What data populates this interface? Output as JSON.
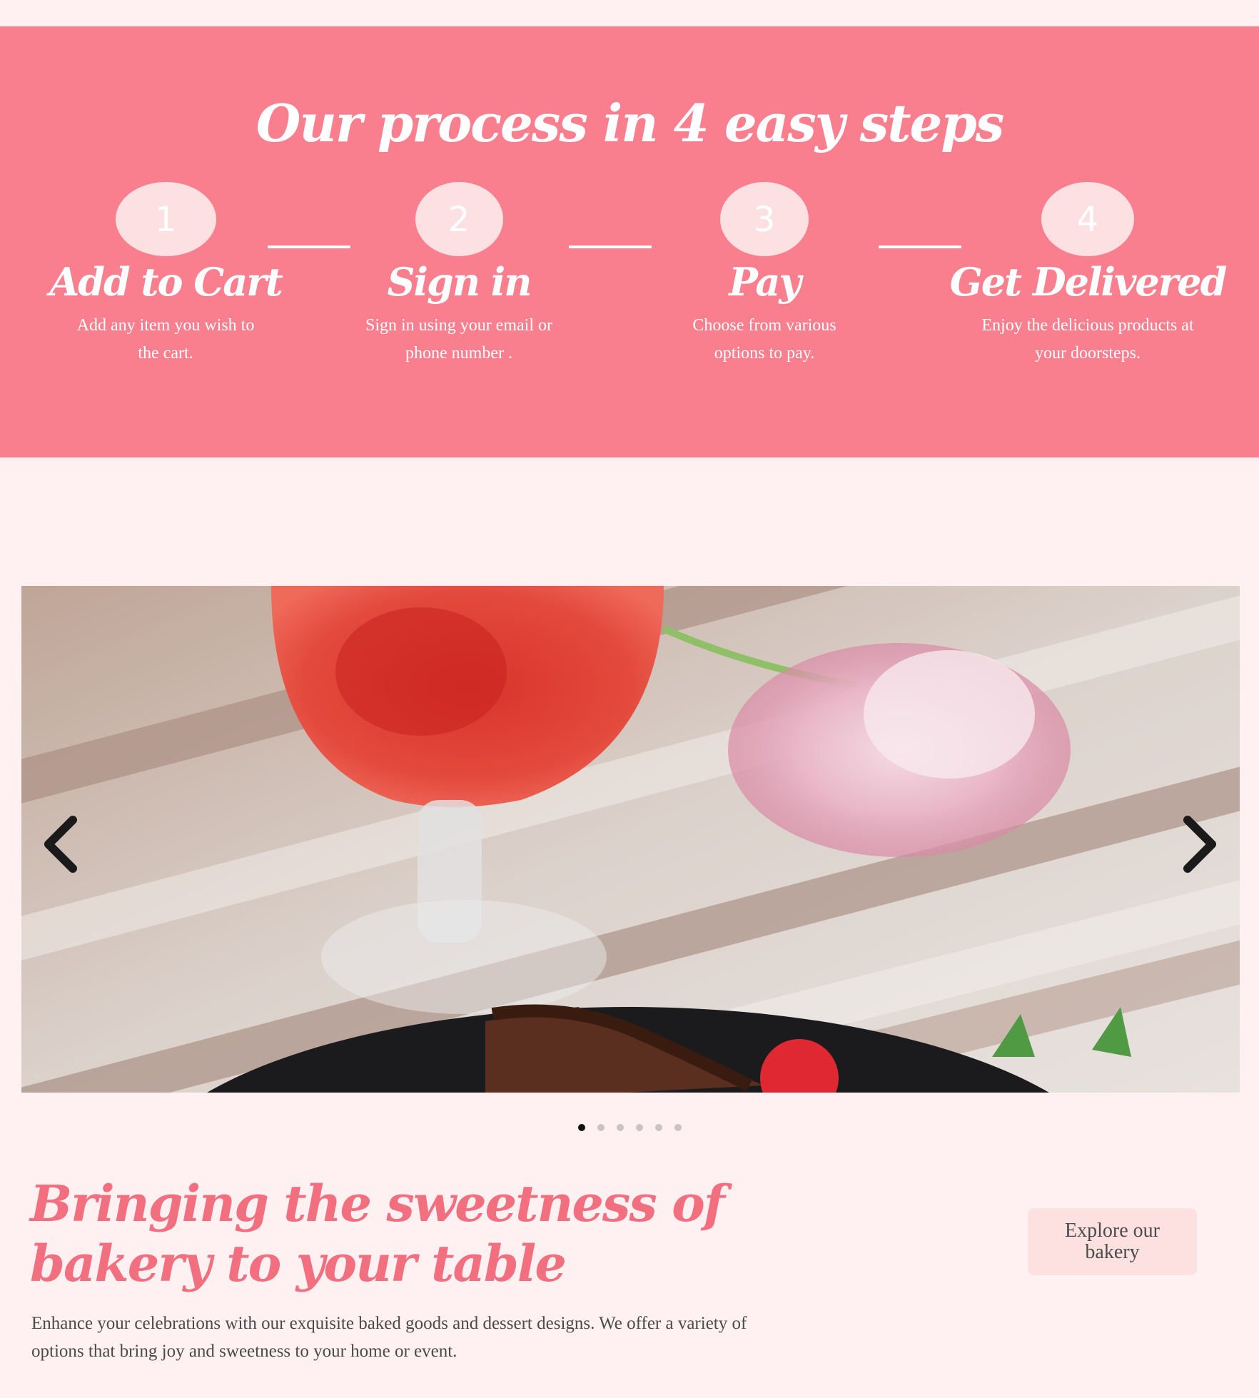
{
  "process": {
    "title": "Our process in 4 easy steps",
    "steps": [
      {
        "number": "1",
        "title": "Add to Cart",
        "desc": "Add any item you wish to the cart."
      },
      {
        "number": "2",
        "title": "Sign in",
        "desc": "Sign in using your email or phone number ."
      },
      {
        "number": "3",
        "title": "Pay",
        "desc": "Choose from various options to pay."
      },
      {
        "number": "4",
        "title": "Get Delivered",
        "desc": "Enjoy the delicious products at your doorsteps."
      }
    ]
  },
  "carousel": {
    "slide_count": 6,
    "active_slide": 1,
    "prev_icon": "chevron-left-icon",
    "next_icon": "chevron-right-icon"
  },
  "intro": {
    "headline": "Bringing the sweetness of bakery to your table",
    "text": "Enhance your celebrations with our exquisite baked goods and dessert designs. We offer a variety of options that bring joy and sweetness to your home or event.",
    "button_label": "Explore our bakery"
  },
  "colors": {
    "page_bg": "#fff0f2",
    "process_bg": "#fa7f8e",
    "accent": "#f26f80",
    "button_bg": "#fde0e0"
  }
}
